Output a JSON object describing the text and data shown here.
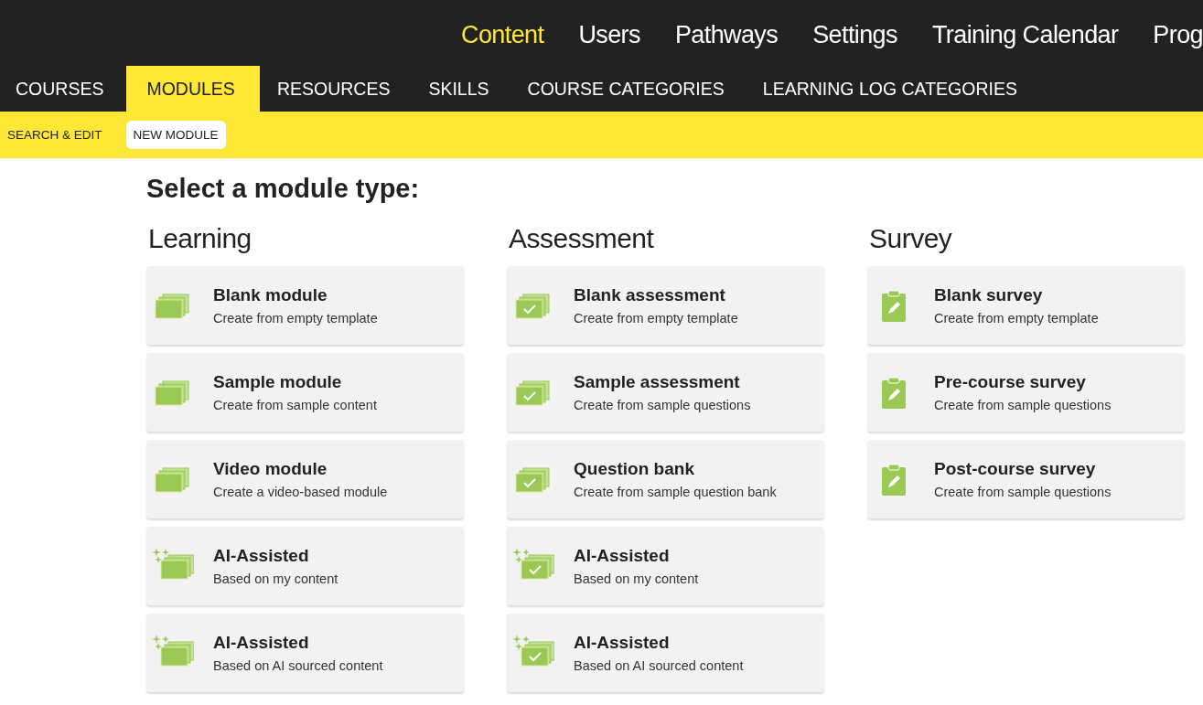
{
  "top_nav": [
    {
      "label": "Content",
      "selected": true
    },
    {
      "label": "Users",
      "selected": false
    },
    {
      "label": "Pathways",
      "selected": false
    },
    {
      "label": "Settings",
      "selected": false
    },
    {
      "label": "Training Calendar",
      "selected": false
    },
    {
      "label": "Prog",
      "selected": false
    }
  ],
  "tabs": [
    {
      "label": "COURSES",
      "selected": false
    },
    {
      "label": "MODULES",
      "selected": true
    },
    {
      "label": "RESOURCES",
      "selected": false
    },
    {
      "label": "SKILLS",
      "selected": false
    },
    {
      "label": "COURSE CATEGORIES",
      "selected": false
    },
    {
      "label": "LEARNING LOG CATEGORIES",
      "selected": false
    }
  ],
  "sub_tabs": [
    {
      "label": "SEARCH & EDIT",
      "selected": false
    },
    {
      "label": "NEW MODULE",
      "selected": true
    }
  ],
  "heading": "Select a module type:",
  "columns": [
    {
      "title": "Learning",
      "cards": [
        {
          "kind": "stack",
          "title": "Blank module",
          "subtitle": "Create from empty template"
        },
        {
          "kind": "stack",
          "title": "Sample module",
          "subtitle": "Create from sample content"
        },
        {
          "kind": "stack",
          "title": "Video module",
          "subtitle": "Create a video-based module"
        },
        {
          "kind": "ai-stack",
          "title": "AI-Assisted",
          "subtitle": "Based on my content"
        },
        {
          "kind": "ai-stack",
          "title": "AI-Assisted",
          "subtitle": "Based on AI sourced content"
        }
      ]
    },
    {
      "title": "Assessment",
      "cards": [
        {
          "kind": "check-stack",
          "title": "Blank assessment",
          "subtitle": "Create from empty template"
        },
        {
          "kind": "check-stack",
          "title": "Sample assessment",
          "subtitle": "Create from sample questions"
        },
        {
          "kind": "check-stack",
          "title": "Question bank",
          "subtitle": "Create from sample question bank"
        },
        {
          "kind": "ai-check-stack",
          "title": "AI-Assisted",
          "subtitle": "Based on my content"
        },
        {
          "kind": "ai-check-stack",
          "title": "AI-Assisted",
          "subtitle": "Based on AI sourced content"
        }
      ]
    },
    {
      "title": "Survey",
      "cards": [
        {
          "kind": "clipboard",
          "title": "Blank survey",
          "subtitle": "Create from empty template"
        },
        {
          "kind": "clipboard",
          "title": "Pre-course survey",
          "subtitle": "Create from sample questions"
        },
        {
          "kind": "clipboard",
          "title": "Post-course survey",
          "subtitle": "Create from sample questions"
        }
      ]
    }
  ]
}
